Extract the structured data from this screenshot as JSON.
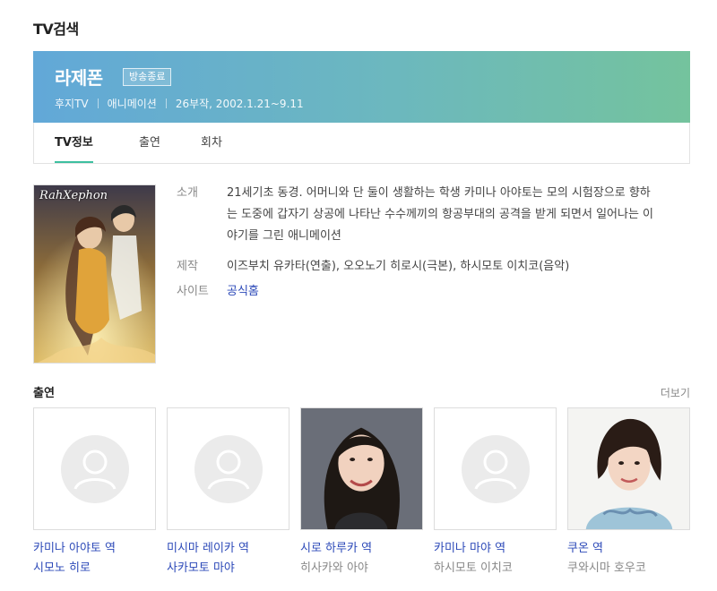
{
  "section_title": "TV검색",
  "program": {
    "title": "라제폰",
    "badge": "방송종료",
    "meta": [
      "후지TV",
      "애니메이션",
      "26부작, 2002.1.21~9.11"
    ]
  },
  "tabs": [
    {
      "label": "TV정보",
      "active": true
    },
    {
      "label": "출연",
      "active": false
    },
    {
      "label": "회차",
      "active": false
    }
  ],
  "poster": {
    "logo_text": "RahXephon",
    "icon": "anime-poster-image"
  },
  "info": {
    "synopsis_label": "소개",
    "synopsis": "21세기초 동경. 어머니와 단 둘이 생활하는 학생 카미나 아야토는 모의 시험장으로 향하는 도중에 갑자기 상공에 나타난 수수께끼의 항공부대의 공격을 받게 되면서 일어나는 이야기를 그린 애니메이션",
    "production_label": "제작",
    "production": "이즈부치 유카타(연출), 오오노기 히로시(극본), 하시모토 이치코(음악)",
    "site_label": "사이트",
    "site_link": "공식홈"
  },
  "cast": {
    "heading": "출연",
    "more_label": "더보기",
    "members": [
      {
        "role": "카미나 아야토 역",
        "actor": "시모노 히로",
        "actor_linked": true,
        "photo": "placeholder"
      },
      {
        "role": "미시마 레이카 역",
        "actor": "사카모토 마야",
        "actor_linked": true,
        "photo": "placeholder"
      },
      {
        "role": "시로 하루카 역",
        "actor": "히사카와 아야",
        "actor_linked": false,
        "photo": "portrait-long-hair"
      },
      {
        "role": "카미나 마야 역",
        "actor": "하시모토 이치코",
        "actor_linked": false,
        "photo": "placeholder"
      },
      {
        "role": "쿠온 역",
        "actor": "쿠와시마 호우코",
        "actor_linked": false,
        "photo": "portrait-short-hair"
      }
    ]
  },
  "colors": {
    "accent": "#3dbfa0",
    "link": "#2c49b8",
    "banner_start": "#62a8d8",
    "banner_end": "#74c39d"
  }
}
